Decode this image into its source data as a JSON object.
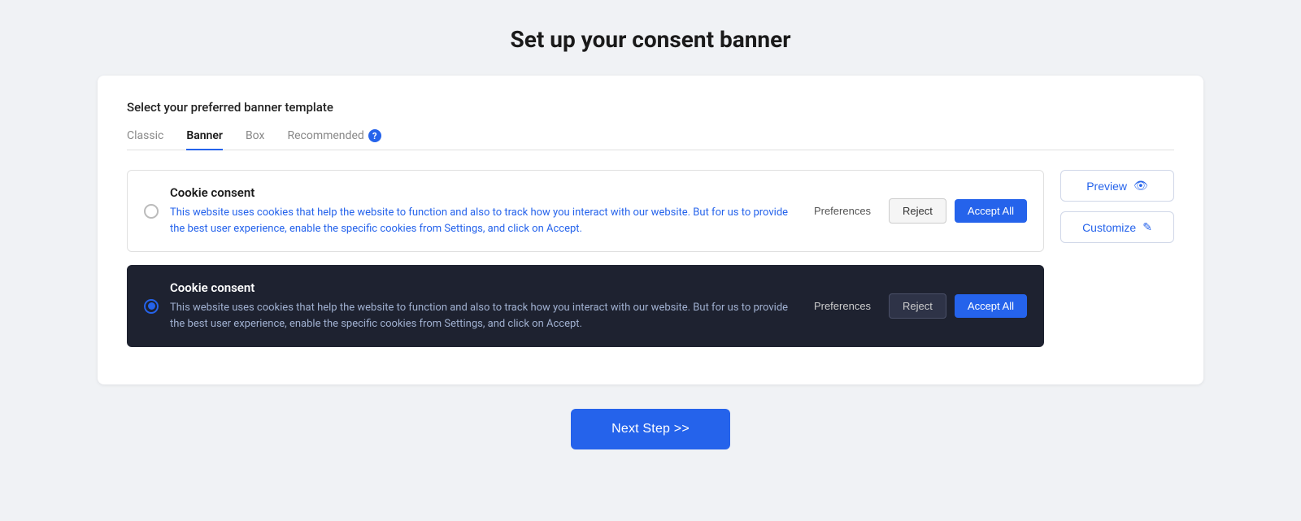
{
  "page": {
    "title": "Set up your consent banner"
  },
  "section": {
    "label": "Select your preferred banner template"
  },
  "tabs": [
    {
      "id": "classic",
      "label": "Classic",
      "active": false
    },
    {
      "id": "banner",
      "label": "Banner",
      "active": true
    },
    {
      "id": "box",
      "label": "Box",
      "active": false
    },
    {
      "id": "recommended",
      "label": "Recommended",
      "active": false
    }
  ],
  "banner_options": [
    {
      "id": "light",
      "selected": false,
      "title": "Cookie consent",
      "description": "This website uses cookies that help the website to function and also to track how you interact with our website. But for us to provide the best user experience, enable the specific cookies from Settings, and click on Accept.",
      "dark": false,
      "btn_preferences": "Preferences",
      "btn_reject": "Reject",
      "btn_accept": "Accept All"
    },
    {
      "id": "dark",
      "selected": true,
      "title": "Cookie consent",
      "description": "This website uses cookies that help the website to function and also to track how you interact with our website. But for us to provide the best user experience, enable the specific cookies from Settings, and click on Accept.",
      "dark": true,
      "btn_preferences": "Preferences",
      "btn_reject": "Reject",
      "btn_accept": "Accept All"
    }
  ],
  "side_actions": {
    "preview_label": "Preview",
    "customize_label": "Customize"
  },
  "footer": {
    "next_step_label": "Next Step >>"
  }
}
